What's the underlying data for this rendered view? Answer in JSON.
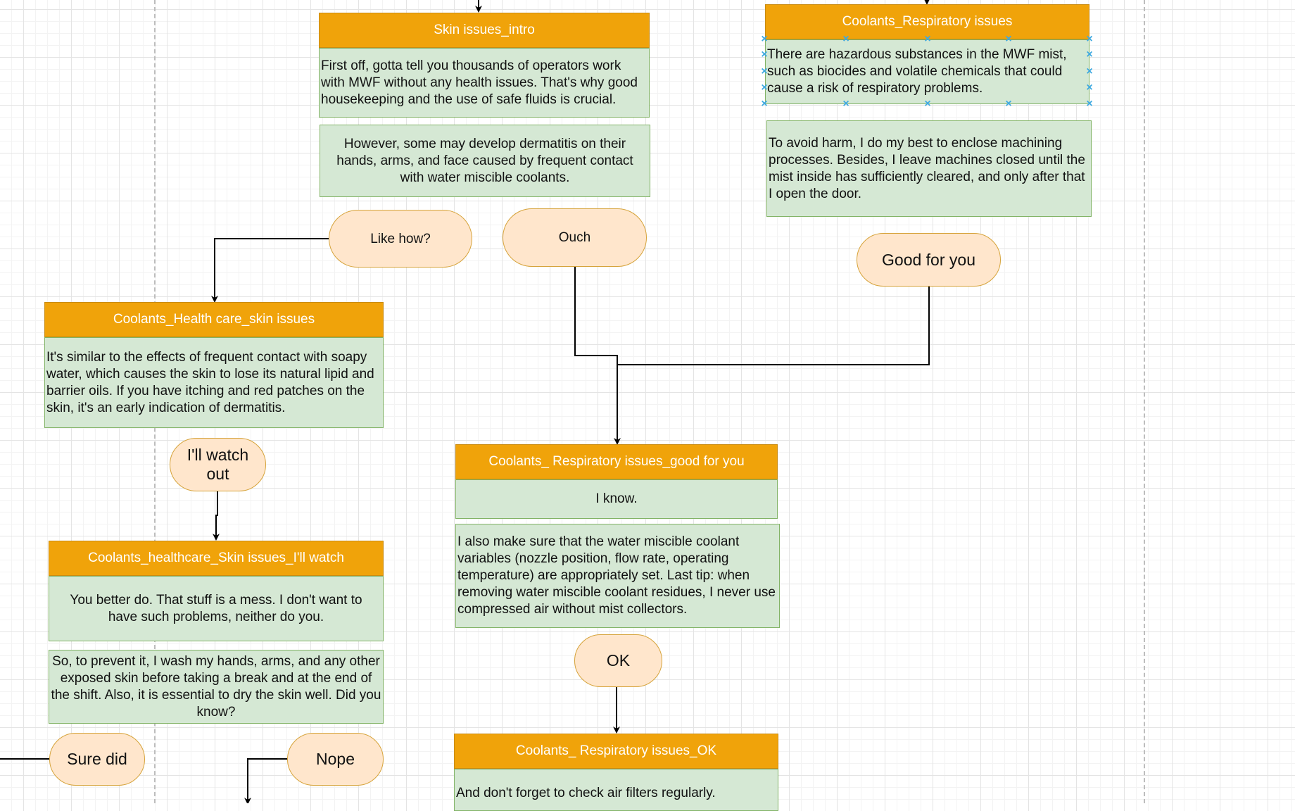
{
  "diagram": {
    "nodes": {
      "skin_intro": {
        "title": "Skin issues_intro",
        "body": [
          "First off, gotta tell you thousands of operators work with MWF without any health issues. That's why good housekeeping and the use of safe fluids is crucial.",
          "However, some may develop dermatitis on their hands, arms, and face caused by frequent contact with water miscible coolants."
        ]
      },
      "respiratory": {
        "title": "Coolants_Respiratory issues",
        "body": [
          "There are hazardous substances in the MWF mist, such as biocides and volatile chemicals that could cause a risk of respiratory problems.",
          "To avoid harm, I do my best to enclose machining processes. Besides, I leave machines closed until the mist inside has sufficiently cleared, and only after that I open the door."
        ]
      },
      "health_skin": {
        "title": "Coolants_Health care_skin issues",
        "body": [
          "It's similar to the effects of frequent contact with soapy water, which causes the skin to lose its natural lipid and barrier oils. If you have itching and red patches on the skin, it's an early indication of dermatitis."
        ]
      },
      "resp_good": {
        "title": "Coolants_ Respiratory issues_good for you",
        "body": [
          "I know.",
          "I also make sure that the water miscible coolant variables (nozzle position, flow rate, operating temperature) are appropriately set. Last tip: when removing water miscible coolant residues, I never use compressed air without mist collectors."
        ]
      },
      "skin_watch": {
        "title": "Coolants_healthcare_Skin issues_I'll watch",
        "body": [
          "You better do. That stuff is a mess. I don't want to have such problems, neither do you.",
          "So, to prevent it, I wash my hands, arms, and any other exposed skin before taking a break and at the end of the shift. Also, it is essential to dry the skin well. Did you know?"
        ]
      },
      "resp_ok": {
        "title": "Coolants_ Respiratory issues_OK",
        "body": [
          "And don't forget to check air filters regularly."
        ]
      }
    },
    "choices": {
      "like_how": "Like how?",
      "ouch": "Ouch",
      "good_for_you": "Good for you",
      "ill_watch_out": "I'll watch out",
      "ok": "OK",
      "sure_did": "Sure did",
      "nope": "Nope"
    },
    "colors": {
      "header_fill": "#f0a30a",
      "body_fill": "#d5e8d4",
      "body_stroke": "#82b366",
      "choice_fill": "#ffe6cc",
      "choice_stroke": "#d6a33a",
      "selection_handle": "#3ea9e0"
    }
  }
}
